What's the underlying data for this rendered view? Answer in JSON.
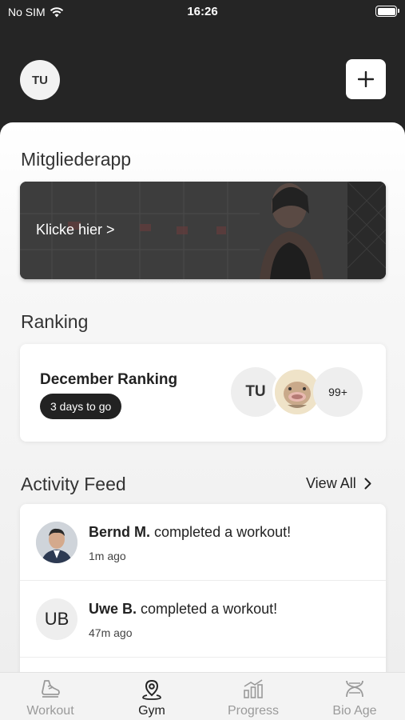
{
  "status_bar": {
    "carrier": "No SIM",
    "time": "16:26"
  },
  "header": {
    "user_initials": "TU"
  },
  "banner_section": {
    "title": "Mitgliederapp",
    "cta": "Klicke hier >"
  },
  "ranking": {
    "title": "Ranking",
    "card_title": "December Ranking",
    "remaining": "3 days to go",
    "participant_initials": "TU",
    "more_count": "99+"
  },
  "activity": {
    "title": "Activity Feed",
    "view_all": "View All",
    "items": [
      {
        "name": "Bernd M.",
        "action": "completed a workout!",
        "time": "1m ago"
      },
      {
        "name": "Uwe B.",
        "action": "completed a workout!",
        "time": "47m ago",
        "initials": "UB"
      }
    ]
  },
  "tabs": [
    {
      "label": "Workout",
      "icon": "shoe-icon",
      "active": false
    },
    {
      "label": "Gym",
      "icon": "location-pin-icon",
      "active": true
    },
    {
      "label": "Progress",
      "icon": "bar-chart-icon",
      "active": false
    },
    {
      "label": "Bio Age",
      "icon": "dna-icon",
      "active": false
    }
  ],
  "colors": {
    "header_bg": "#252525",
    "accent": "#222222",
    "inactive_tab": "#9a9a9a"
  }
}
